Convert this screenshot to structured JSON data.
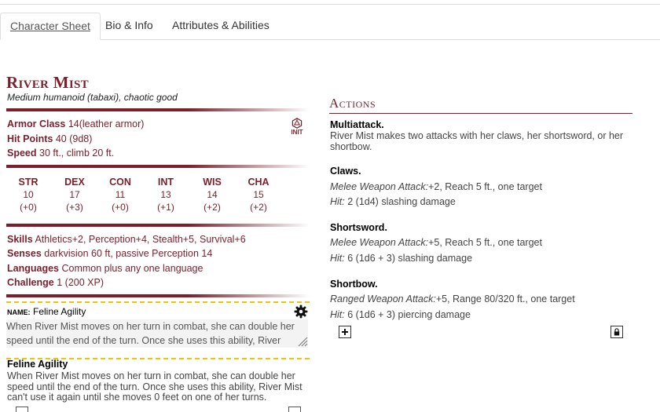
{
  "tabs": [
    {
      "label": "Character Sheet",
      "active": true
    },
    {
      "label": "Bio & Info",
      "active": false
    },
    {
      "label": "Attributes & Abilities",
      "active": false
    }
  ],
  "creature": {
    "name": "River Mist",
    "subtitle": "Medium humanoid (tabaxi), chaotic good",
    "armor_class_label": "Armor Class",
    "armor_class_value": "14",
    "armor_class_note": "(leather armor)",
    "hit_points_label": "Hit Points",
    "hit_points_value": "40",
    "hit_points_note": "(9d8)",
    "speed_label": "Speed",
    "speed_value": "30 ft., climb 20 ft.",
    "init_label": "INIT"
  },
  "abilities": [
    {
      "label": "STR",
      "score": "10",
      "mod": "(+0)"
    },
    {
      "label": "DEX",
      "score": "17",
      "mod": "(+3)"
    },
    {
      "label": "CON",
      "score": "11",
      "mod": "(+0)"
    },
    {
      "label": "INT",
      "score": "13",
      "mod": "(+1)"
    },
    {
      "label": "WIS",
      "score": "14",
      "mod": "(+2)"
    },
    {
      "label": "CHA",
      "score": "15",
      "mod": "(+2)"
    }
  ],
  "details": {
    "skills_label": "Skills",
    "skills_value": "Athletics+2, Perception+4, Stealth+5, Survival+6",
    "senses_label": "Senses",
    "senses_value": "darkvision 60 ft, passive Perception 14",
    "languages_label": "Languages",
    "languages_value": "Common plus any one language",
    "challenge_label": "Challenge",
    "challenge_value": "1 (200 XP)"
  },
  "editor": {
    "name_label": "NAME:",
    "name_value": "Feline Agility",
    "text": "When River Mist moves on her turn in combat, she can double her speed until the end of the turn. Once she uses this ability, River"
  },
  "feature": {
    "title": "Feline Agility",
    "text": "When River Mist moves on her turn in combat, she can double her speed until the end of the turn. Once she uses this ability, River Mist can't use it again until she moves 0 feet on one of her turns."
  },
  "actions": {
    "title": "Actions",
    "multiattack_name": "Multiattack.",
    "multiattack_desc": "River Mist makes two attacks with her claws, her shortsword, or her shortbow.",
    "claws_name": "Claws.",
    "claws_attack_type": "Melee Weapon Attack:",
    "claws_attack": "+2, Reach 5 ft., one target",
    "claws_hit_label": "Hit:",
    "claws_hit": "2 (1d4) slashing damage",
    "shortsword_name": "Shortsword.",
    "shortsword_attack_type": "Melee Weapon Attack:",
    "shortsword_attack": "+5, Reach 5 ft., one target",
    "shortsword_hit_label": "Hit:",
    "shortsword_hit": "6 (1d6 + 3) slashing damage",
    "shortbow_name": "Shortbow.",
    "shortbow_attack_type": "Ranged Weapon Attack:",
    "shortbow_attack": "+5, Range 80/320 ft., one target",
    "shortbow_hit_label": "Hit:",
    "shortbow_hit": "6 (1d6 + 3) piercing damage"
  },
  "icons": {
    "add": "plus-icon",
    "lock": "lock-icon",
    "settings": "gear-icon",
    "initiative": "d20-icon"
  },
  "colors": {
    "accent": "#7a1f2b",
    "editor_border": "#f5c400"
  }
}
